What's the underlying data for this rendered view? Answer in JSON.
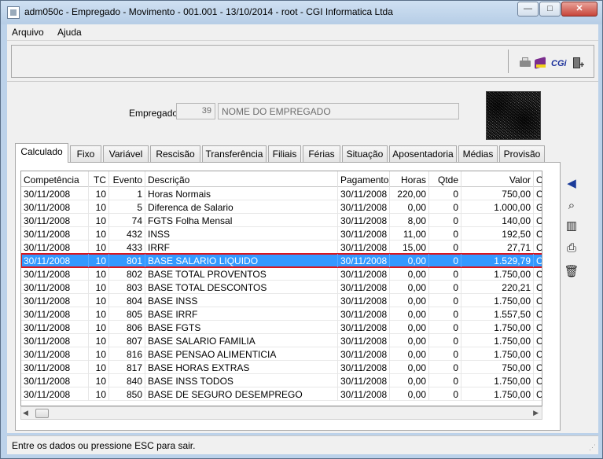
{
  "window": {
    "title": "adm050c - Empregado - Movimento - 001.001 - 13/10/2014 - root - CGI Informatica Ltda",
    "minimize_label": "—",
    "maximize_label": "□",
    "close_label": "✕"
  },
  "menu": {
    "arquivo": "Arquivo",
    "ajuda": "Ajuda"
  },
  "toolbar": {
    "icons": [
      "printer-icon",
      "book-icon",
      "cgi-logo",
      "exit-icon"
    ],
    "cgi_text": "CGi",
    "exit_glyph": "+"
  },
  "employee": {
    "label": "Empregado:",
    "code": "39",
    "name": "NOME DO EMPREGADO"
  },
  "tabs": [
    {
      "label": "Calculado"
    },
    {
      "label": "Fixo"
    },
    {
      "label": "Variável"
    },
    {
      "label": "Rescisão"
    },
    {
      "label": "Transferência"
    },
    {
      "label": "Filiais"
    },
    {
      "label": "Férias"
    },
    {
      "label": "Situação"
    },
    {
      "label": "Aposentadoria"
    },
    {
      "label": "Médias"
    },
    {
      "label": "Provisão"
    }
  ],
  "grid": {
    "columns": [
      "Competência",
      "TC",
      "Evento",
      "Descrição",
      "Pagamento",
      "Horas",
      "Qtde",
      "Valor",
      "O"
    ],
    "rows": [
      [
        "30/11/2008",
        "10",
        "1",
        "Horas Normais",
        "30/11/2008",
        "220,00",
        "0",
        "750,00",
        "C"
      ],
      [
        "30/11/2008",
        "10",
        "5",
        "Diferenca de Salario",
        "30/11/2008",
        "0,00",
        "0",
        "1.000,00",
        "G"
      ],
      [
        "30/11/2008",
        "10",
        "74",
        "FGTS Folha Mensal",
        "30/11/2008",
        "8,00",
        "0",
        "140,00",
        "C"
      ],
      [
        "30/11/2008",
        "10",
        "432",
        "INSS",
        "30/11/2008",
        "11,00",
        "0",
        "192,50",
        "C"
      ],
      [
        "30/11/2008",
        "10",
        "433",
        "IRRF",
        "30/11/2008",
        "15,00",
        "0",
        "27,71",
        "C"
      ],
      [
        "30/11/2008",
        "10",
        "801",
        "BASE SALARIO LIQUIDO",
        "30/11/2008",
        "0,00",
        "0",
        "1.529,79",
        "C"
      ],
      [
        "30/11/2008",
        "10",
        "802",
        "BASE TOTAL PROVENTOS",
        "30/11/2008",
        "0,00",
        "0",
        "1.750,00",
        "C"
      ],
      [
        "30/11/2008",
        "10",
        "803",
        "BASE TOTAL DESCONTOS",
        "30/11/2008",
        "0,00",
        "0",
        "220,21",
        "C"
      ],
      [
        "30/11/2008",
        "10",
        "804",
        "BASE INSS",
        "30/11/2008",
        "0,00",
        "0",
        "1.750,00",
        "C"
      ],
      [
        "30/11/2008",
        "10",
        "805",
        "BASE IRRF",
        "30/11/2008",
        "0,00",
        "0",
        "1.557,50",
        "C"
      ],
      [
        "30/11/2008",
        "10",
        "806",
        "BASE FGTS",
        "30/11/2008",
        "0,00",
        "0",
        "1.750,00",
        "C"
      ],
      [
        "30/11/2008",
        "10",
        "807",
        "BASE SALARIO FAMILIA",
        "30/11/2008",
        "0,00",
        "0",
        "1.750,00",
        "C"
      ],
      [
        "30/11/2008",
        "10",
        "816",
        "BASE PENSAO ALIMENTICIA",
        "30/11/2008",
        "0,00",
        "0",
        "1.750,00",
        "C"
      ],
      [
        "30/11/2008",
        "10",
        "817",
        "BASE HORAS EXTRAS",
        "30/11/2008",
        "0,00",
        "0",
        "750,00",
        "C"
      ],
      [
        "30/11/2008",
        "10",
        "840",
        "BASE INSS TODOS",
        "30/11/2008",
        "0,00",
        "0",
        "1.750,00",
        "C"
      ],
      [
        "30/11/2008",
        "10",
        "850",
        "BASE DE SEGURO DESEMPREGO",
        "30/11/2008",
        "0,00",
        "0",
        "1.750,00",
        "C"
      ]
    ],
    "selected_row": 5
  },
  "side_tools": {
    "icons": [
      "filter-icon",
      "search-icon",
      "columns-icon",
      "print-icon",
      "trash-icon"
    ],
    "filter_glyph": "◀",
    "search_glyph": "⌕",
    "columns_glyph": "▥",
    "print_glyph": "⎙",
    "trash_glyph": "🗑"
  },
  "scrollbar": {
    "left_glyph": "◀",
    "right_glyph": "▶"
  },
  "status": {
    "text": "Entre os dados ou pressione ESC para sair."
  },
  "colors": {
    "selection": "#3399ff",
    "selection_border": "#d9161e",
    "frame": "#bcd2ea"
  }
}
